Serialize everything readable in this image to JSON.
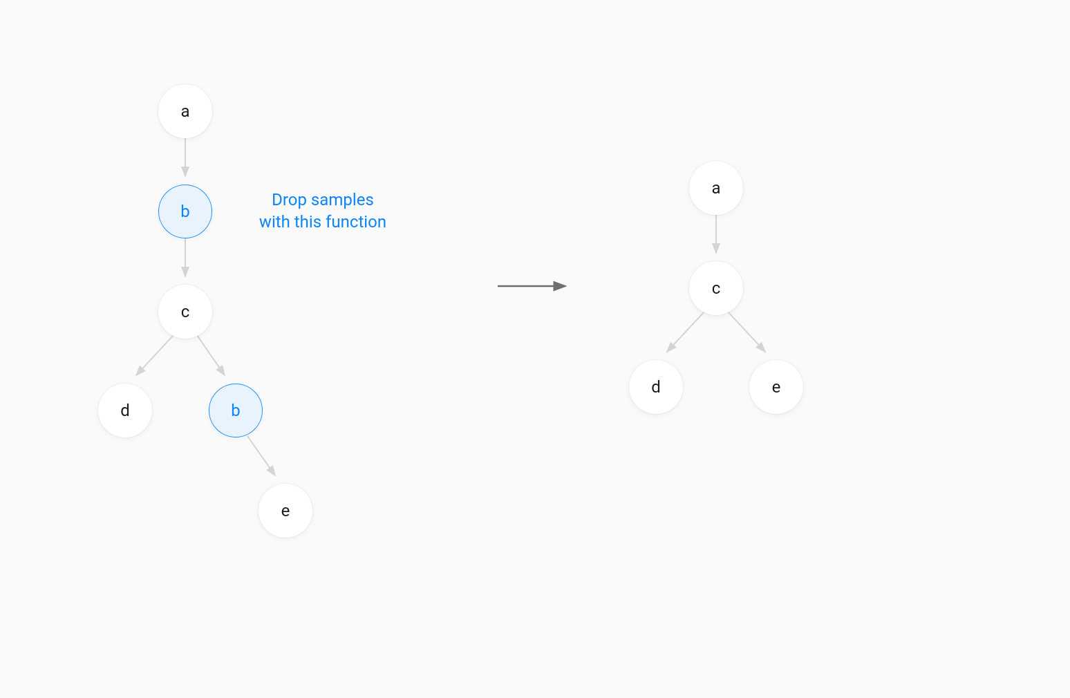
{
  "left_tree": {
    "a": "a",
    "b1": "b",
    "c": "c",
    "d": "d",
    "b2": "b",
    "e": "e"
  },
  "right_tree": {
    "a": "a",
    "c": "c",
    "d": "d",
    "e": "e"
  },
  "annotation": {
    "line1": "Drop samples",
    "line2": "with this function"
  },
  "colors": {
    "highlight_border": "#1E90FF",
    "highlight_fill": "#e8f3fd",
    "highlight_text": "#0a84ff",
    "arrow_light": "#d4d4d4",
    "arrow_dark": "#6e6e6e"
  }
}
